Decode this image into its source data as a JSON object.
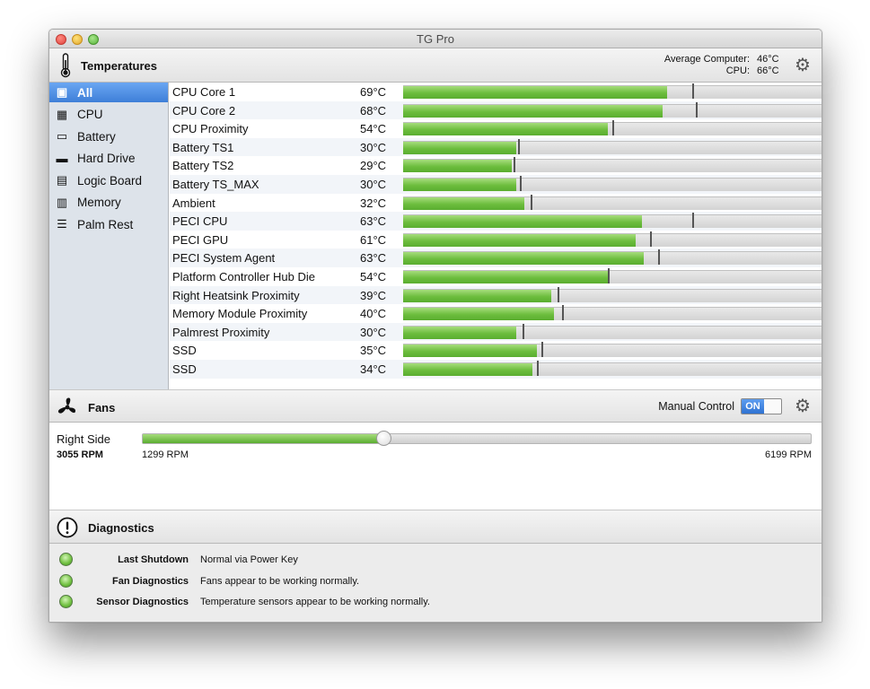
{
  "window": {
    "title": "TG Pro"
  },
  "temperatures": {
    "header_label": "Temperatures",
    "average_label": "Average Computer:",
    "average_value": "46°C",
    "cpu_label": "CPU:",
    "cpu_value": "66°C"
  },
  "sidebar": {
    "items": [
      {
        "label": "All",
        "icon": "computer-icon"
      },
      {
        "label": "CPU",
        "icon": "cpu-chip-icon"
      },
      {
        "label": "Battery",
        "icon": "battery-icon"
      },
      {
        "label": "Hard Drive",
        "icon": "hard-drive-icon"
      },
      {
        "label": "Logic Board",
        "icon": "logic-board-icon"
      },
      {
        "label": "Memory",
        "icon": "memory-icon"
      },
      {
        "label": "Palm Rest",
        "icon": "palm-rest-icon"
      }
    ]
  },
  "sensors": [
    {
      "name": "CPU Core 1",
      "temp": "69°C",
      "level": 0.63,
      "max": 0.69
    },
    {
      "name": "CPU Core 2",
      "temp": "68°C",
      "level": 0.62,
      "max": 0.7
    },
    {
      "name": "CPU Proximity",
      "temp": "54°C",
      "level": 0.49,
      "max": 0.5
    },
    {
      "name": "Battery TS1",
      "temp": "30°C",
      "level": 0.27,
      "max": 0.275
    },
    {
      "name": "Battery TS2",
      "temp": "29°C",
      "level": 0.26,
      "max": 0.265
    },
    {
      "name": "Battery TS_MAX",
      "temp": "30°C",
      "level": 0.27,
      "max": 0.28
    },
    {
      "name": "Ambient",
      "temp": "32°C",
      "level": 0.29,
      "max": 0.305
    },
    {
      "name": "PECI CPU",
      "temp": "63°C",
      "level": 0.57,
      "max": 0.69
    },
    {
      "name": "PECI GPU",
      "temp": "61°C",
      "level": 0.555,
      "max": 0.59
    },
    {
      "name": "PECI System Agent",
      "temp": "63°C",
      "level": 0.575,
      "max": 0.61
    },
    {
      "name": "Platform Controller Hub Die",
      "temp": "54°C",
      "level": 0.49,
      "max": 0.49
    },
    {
      "name": "Right Heatsink Proximity",
      "temp": "39°C",
      "level": 0.355,
      "max": 0.37
    },
    {
      "name": "Memory Module Proximity",
      "temp": "40°C",
      "level": 0.36,
      "max": 0.38
    },
    {
      "name": "Palmrest Proximity",
      "temp": "30°C",
      "level": 0.27,
      "max": 0.285
    },
    {
      "name": "SSD",
      "temp": "35°C",
      "level": 0.32,
      "max": 0.33
    },
    {
      "name": "SSD",
      "temp": "34°C",
      "level": 0.31,
      "max": 0.32
    }
  ],
  "fans": {
    "header_label": "Fans",
    "manual_control_label": "Manual Control",
    "toggle_state": "ON",
    "fan": {
      "name": "Right Side",
      "current_rpm": "3055 RPM",
      "min_rpm": "1299 RPM",
      "max_rpm": "6199 RPM",
      "slider_level": 0.36
    }
  },
  "diagnostics": {
    "header_label": "Diagnostics",
    "rows": [
      {
        "label": "Last Shutdown",
        "value": "Normal via Power Key"
      },
      {
        "label": "Fan Diagnostics",
        "value": "Fans appear to be working normally."
      },
      {
        "label": "Sensor Diagnostics",
        "value": "Temperature sensors appear to be working normally."
      }
    ]
  },
  "colors": {
    "bar_green": "#6cbd3d",
    "selection_blue": "#3e7fd8",
    "sidebar_bg": "#dde3ea"
  }
}
